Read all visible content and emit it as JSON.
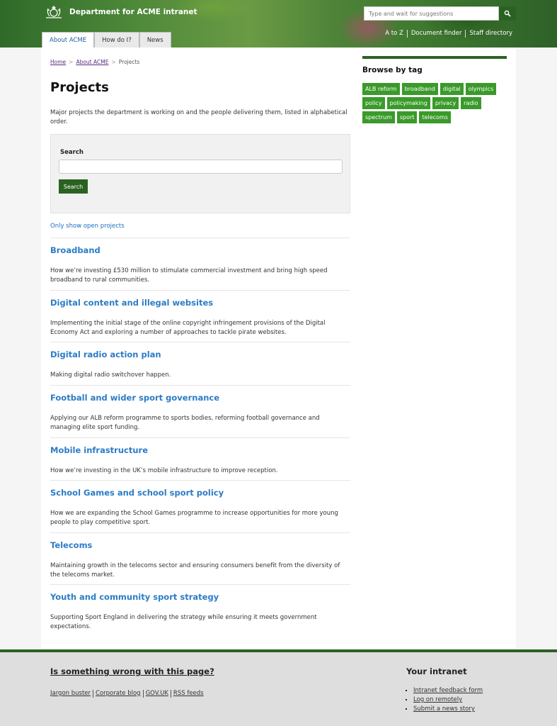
{
  "header": {
    "brand": "Department for ACME intranet",
    "search_placeholder": "Type and wait for suggestions",
    "util_links": [
      "A to Z",
      "Document finder",
      "Staff directory"
    ],
    "tabs": [
      "About ACME",
      "How do I?",
      "News"
    ]
  },
  "breadcrumb": {
    "home": "Home",
    "about": "About ACME",
    "current": "Projects",
    "separator": ">"
  },
  "page": {
    "title": "Projects",
    "intro": "Major projects the department is working on and the people delivering them, listed in alphabetical order.",
    "search_label": "Search",
    "search_button": "Search",
    "open_link": "Only show open projects"
  },
  "projects": [
    {
      "title": "Broadband",
      "desc": "How we’re investing £530 million to stimulate commercial investment and bring high speed broadband to rural communities."
    },
    {
      "title": "Digital content and illegal websites",
      "desc": "Implementing the initial stage of the online copyright infringement provisions of the Digital Economy Act and exploring a number of approaches to tackle pirate websites."
    },
    {
      "title": "Digital radio action plan",
      "desc": "Making digital radio switchover happen."
    },
    {
      "title": "Football and wider sport governance",
      "desc": "Applying our ALB reform programme to sports bodies, reforming football governance and managing elite sport funding."
    },
    {
      "title": "Mobile infrastructure",
      "desc": "How we’re investing in the UK’s mobile infrastructure to improve reception."
    },
    {
      "title": "School Games and school sport policy",
      "desc": "How we are expanding the School Games programme to increase opportunities for more young people to play competitive sport."
    },
    {
      "title": "Telecoms",
      "desc": "Maintaining growth in the telecoms sector and ensuring consumers benefit from the diversity of the telecoms market."
    },
    {
      "title": "Youth and community sport strategy",
      "desc": "Supporting Sport England in delivering the strategy while ensuring it meets government expectations."
    }
  ],
  "sidebar": {
    "title": "Browse by tag",
    "tags": [
      "ALB reform",
      "broadband",
      "digital",
      "olympics",
      "policy",
      "policymaking",
      "privacy",
      "radio",
      "spectrum",
      "sport",
      "telecoms"
    ]
  },
  "footer": {
    "heading": "Is something wrong with this page?",
    "links": [
      "Jargon buster",
      "Corporate blog",
      "GOV.UK",
      "RSS feeds"
    ],
    "right_title": "Your intranet",
    "right_links": [
      "Intranet feedback form",
      "Log on remotely",
      "Submit a news story"
    ]
  },
  "colors": {
    "brand_green": "#2a6321",
    "tag_green": "#3a9a2a",
    "link_blue": "#2b7cc6"
  }
}
